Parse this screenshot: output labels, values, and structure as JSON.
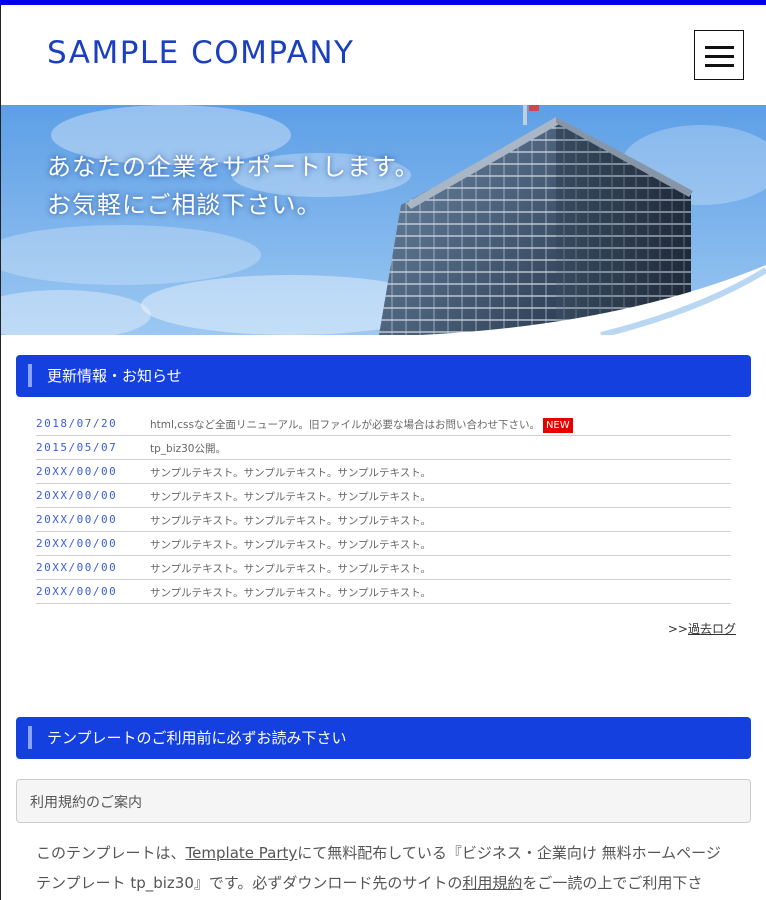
{
  "header": {
    "logo": "SAMPLE COMPANY",
    "menu_icon": "hamburger-menu-icon"
  },
  "hero": {
    "line1": "あなたの企業をサポートします。",
    "line2": "お気軽にご相談下さい。"
  },
  "news": {
    "heading": "更新情報・お知らせ",
    "items": [
      {
        "date": "2018/07/20",
        "text": "html,cssなど全面リニューアル。旧ファイルが必要な場合はお問い合わせ下さい。",
        "badge": "NEW"
      },
      {
        "date": "2015/05/07",
        "text": "tp_biz30公開。"
      },
      {
        "date": "20XX/00/00",
        "text": "サンプルテキスト。サンプルテキスト。サンプルテキスト。"
      },
      {
        "date": "20XX/00/00",
        "text": "サンプルテキスト。サンプルテキスト。サンプルテキスト。"
      },
      {
        "date": "20XX/00/00",
        "text": "サンプルテキスト。サンプルテキスト。サンプルテキスト。"
      },
      {
        "date": "20XX/00/00",
        "text": "サンプルテキスト。サンプルテキスト。サンプルテキスト。"
      },
      {
        "date": "20XX/00/00",
        "text": "サンプルテキスト。サンプルテキスト。サンプルテキスト。"
      },
      {
        "date": "20XX/00/00",
        "text": "サンプルテキスト。サンプルテキスト。サンプルテキスト。"
      }
    ],
    "past_prefix": ">>",
    "past_link": "過去ログ"
  },
  "template": {
    "heading": "テンプレートのご利用前に必ずお読み下さい",
    "box_label": "利用規約のご案内",
    "line1_a": "このテンプレートは、",
    "line1_link": "Template Party",
    "line1_b": "にて無料配布している『ビジネス・企業向け 無料ホームページ",
    "line2_a": "テンプレート tp_biz30』です。必ずダウンロード先のサイトの",
    "line2_link": "利用規約",
    "line2_b": "をご一読の上でご利用下さ"
  },
  "colors": {
    "accent": "#1540e0",
    "logo": "#1a3fbf",
    "top_bar": "#0000e6",
    "new_badge": "#e60000"
  }
}
